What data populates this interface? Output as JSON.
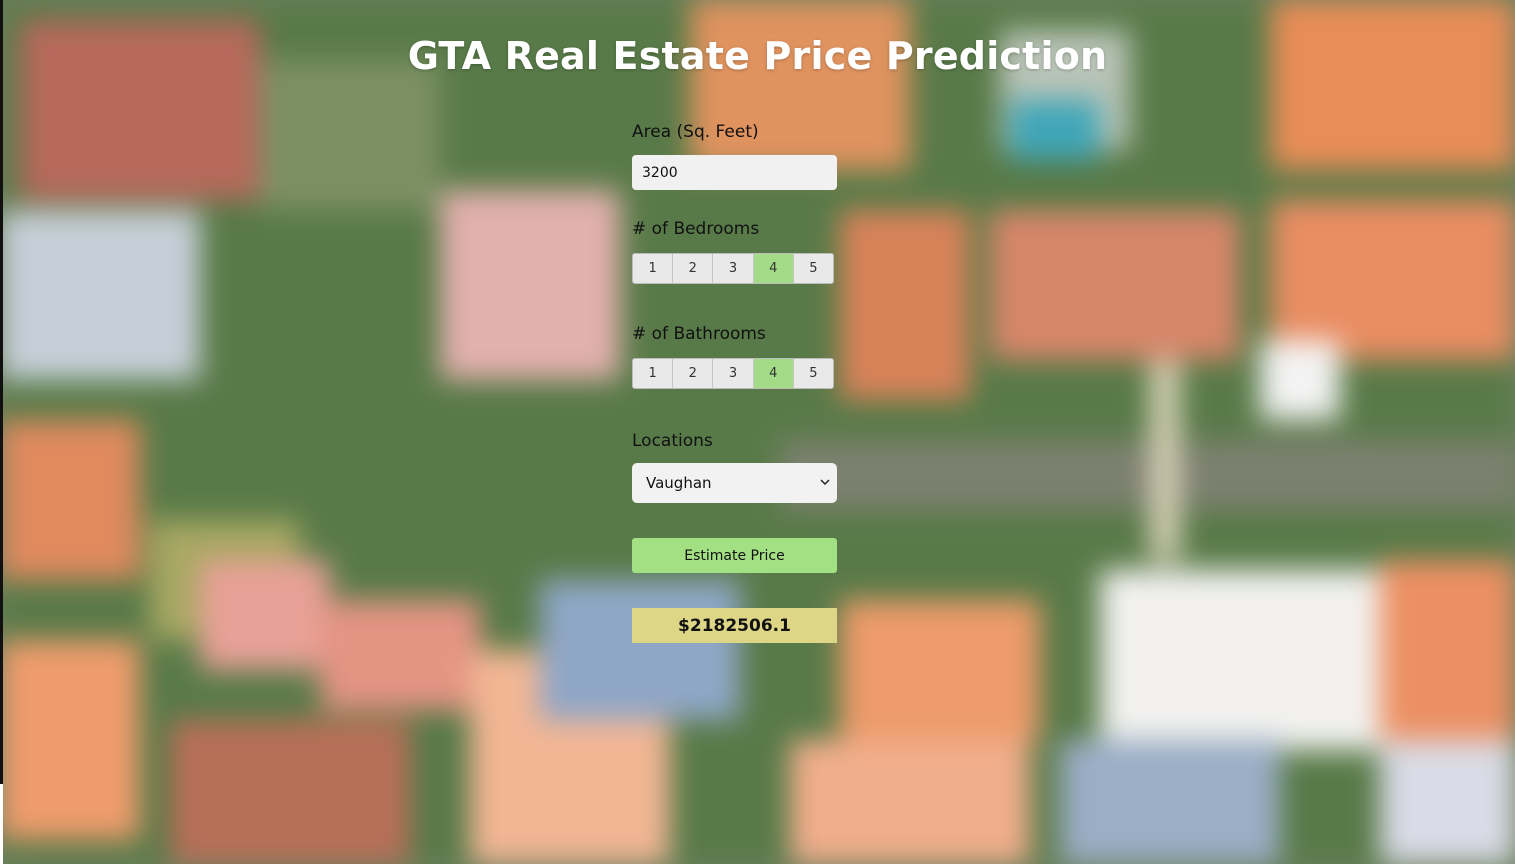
{
  "page": {
    "title": "GTA Real Estate Price Prediction"
  },
  "form": {
    "area_label": "Area (Sq. Feet)",
    "area_value": "3200",
    "bedrooms_label": "# of Bedrooms",
    "bedrooms_options": [
      "1",
      "2",
      "3",
      "4",
      "5"
    ],
    "bedrooms_selected": "4",
    "bathrooms_label": "# of Bathrooms",
    "bathrooms_options": [
      "1",
      "2",
      "3",
      "4",
      "5"
    ],
    "bathrooms_selected": "4",
    "location_label": "Locations",
    "location_selected": "Vaughan",
    "estimate_button": "Estimate Price",
    "result": "$2182506.1"
  },
  "icons": {
    "select_arrow": "chevron-down-icon"
  },
  "colors": {
    "selected_option": "#a3db86",
    "estimate_button": "#a3e083",
    "result_box": "#ddd686"
  }
}
